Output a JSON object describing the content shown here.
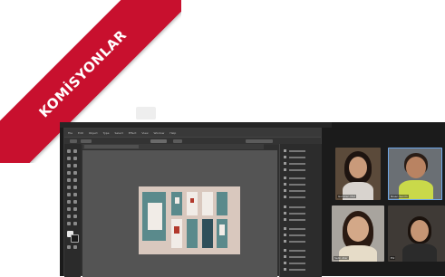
{
  "banner": {
    "text": "KOMİSYONLAR",
    "color": "#c8102e"
  },
  "editor": {
    "menu": [
      "File",
      "Edit",
      "Object",
      "Type",
      "Select",
      "Effect",
      "View",
      "Window",
      "Help"
    ],
    "accent": "#5a8a8c"
  },
  "call": {
    "participants": [
      {
        "name": "Gulistan Mat"
      },
      {
        "name": "Nisan Sevim"
      },
      {
        "name": "Selin Atar"
      },
      {
        "name": "Elz"
      }
    ],
    "active_color": "#6fa7e8"
  }
}
